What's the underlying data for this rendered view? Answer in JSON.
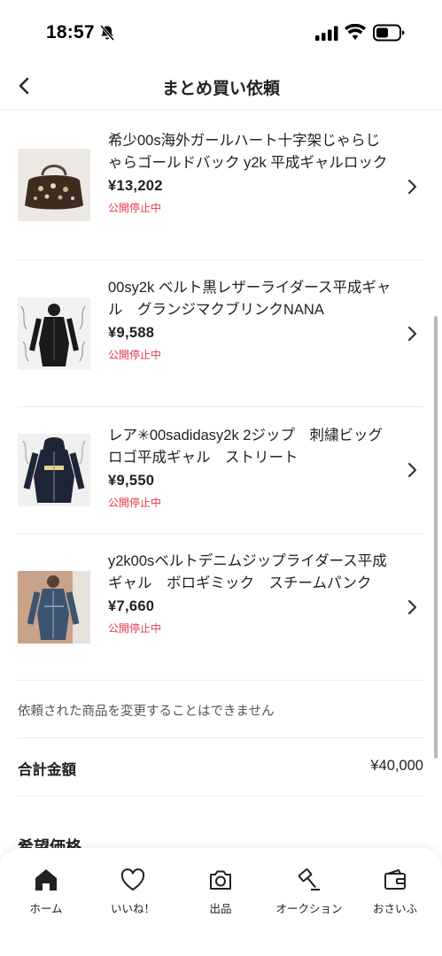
{
  "status_bar": {
    "time": "18:57"
  },
  "header": {
    "title": "まとめ買い依頼"
  },
  "items": [
    {
      "title": "希少00s海外ガールハート十字架じゃらじゃらゴールドバック y2k 平成ギャルロック",
      "price": "¥13,202",
      "status": "公開停止中"
    },
    {
      "title": "00sy2k ベルト黒レザーライダース平成ギャル　グランジマクブリンクNANA",
      "price": "¥9,588",
      "status": "公開停止中"
    },
    {
      "title": "レア✳︎00sadidasy2k 2ジップ　刺繍ビッグロゴ平成ギャル　ストリート",
      "price": "¥9,550",
      "status": "公開停止中"
    },
    {
      "title": "y2k00sベルトデニムジップライダース平成ギャル　ボロギミック　スチームパンク",
      "price": "¥7,660",
      "status": "公開停止中"
    }
  ],
  "notice": "依頼された商品を変更することはできません",
  "total": {
    "label": "合計金額",
    "value": "¥40,000"
  },
  "desired_price_label": "希望価格",
  "tabs": [
    {
      "label": "ホーム",
      "icon": "home-icon"
    },
    {
      "label": "いいね！",
      "icon": "heart-icon"
    },
    {
      "label": "出品",
      "icon": "camera-icon"
    },
    {
      "label": "オークション",
      "icon": "gavel-icon"
    },
    {
      "label": "おさいふ",
      "icon": "wallet-icon"
    }
  ],
  "colors": {
    "status_red": "#e8374a",
    "text": "#222222",
    "divider": "#ececec"
  }
}
